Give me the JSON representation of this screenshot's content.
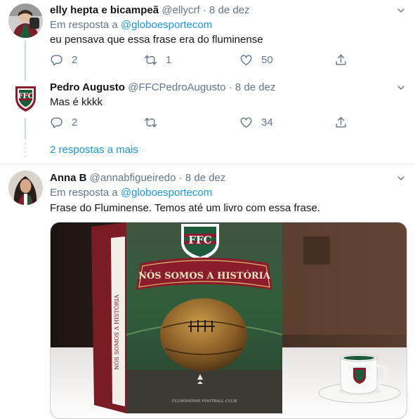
{
  "tweets": [
    {
      "name": "elly hepta e bicampeã",
      "handle": "@ellycrf",
      "separator": "·",
      "date": "8 de dez",
      "reply_prefix": "Em resposta a",
      "reply_to": "@globoesportecom",
      "text": "eu pensava que essa frase era do fluminense",
      "replies": "2",
      "retweets": "1",
      "likes": "50"
    },
    {
      "name": "Pedro Augusto",
      "handle": "@FFCPedroAugusto",
      "separator": "·",
      "date": "8 de dez",
      "text": "Mas é kkkk",
      "replies": "2",
      "retweets": "",
      "likes": "34"
    },
    {
      "name": "Anna B",
      "handle": "@annabfigueiredo",
      "separator": "·",
      "date": "8 de dez",
      "reply_prefix": "Em resposta a",
      "reply_to": "@globoesportecom",
      "text": "Frase do Fluminense. Temos até um livro com essa frase."
    }
  ],
  "more_replies": "2 respostas a mais",
  "media": {
    "book_title": "NÓS SOMOS A HISTÓRIA",
    "book_spine": "NÓS SOMOS A HISTÓRIA",
    "book_footer": "FLUMINENSE FOOTBALL CLUB",
    "crest_letters": "FFC"
  },
  "colors": {
    "link": "#1b95e0",
    "secondary": "#657786",
    "club_green": "#1d5b3a",
    "club_maroon": "#8a1c2b"
  },
  "icons": [
    "reply-icon",
    "retweet-icon",
    "like-icon",
    "share-icon",
    "chevron-down-icon"
  ]
}
